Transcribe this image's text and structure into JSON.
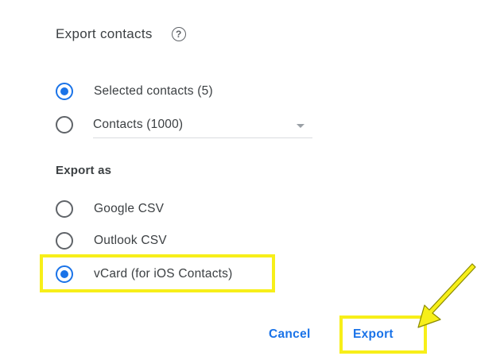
{
  "dialog": {
    "title": "Export contacts",
    "help_icon_glyph": "?"
  },
  "contacts_options": [
    {
      "label": "Selected contacts (5)",
      "checked": true
    },
    {
      "label": "",
      "checked": false
    }
  ],
  "contacts_select": {
    "value": "Contacts (1000)"
  },
  "export_as": {
    "heading": "Export as",
    "options": [
      {
        "label": "Google CSV",
        "checked": false
      },
      {
        "label": "Outlook CSV",
        "checked": false
      },
      {
        "label": "vCard (for iOS Contacts)",
        "checked": true
      }
    ]
  },
  "actions": {
    "cancel_label": "Cancel",
    "export_label": "Export"
  },
  "colors": {
    "accent": "#1a73e8",
    "highlight": "#f7ef19",
    "text": "#3c4043"
  },
  "icons": {
    "help": "help-circle-icon",
    "dropdown": "chevron-down-icon",
    "pointer": "arrow-pointer-icon"
  }
}
